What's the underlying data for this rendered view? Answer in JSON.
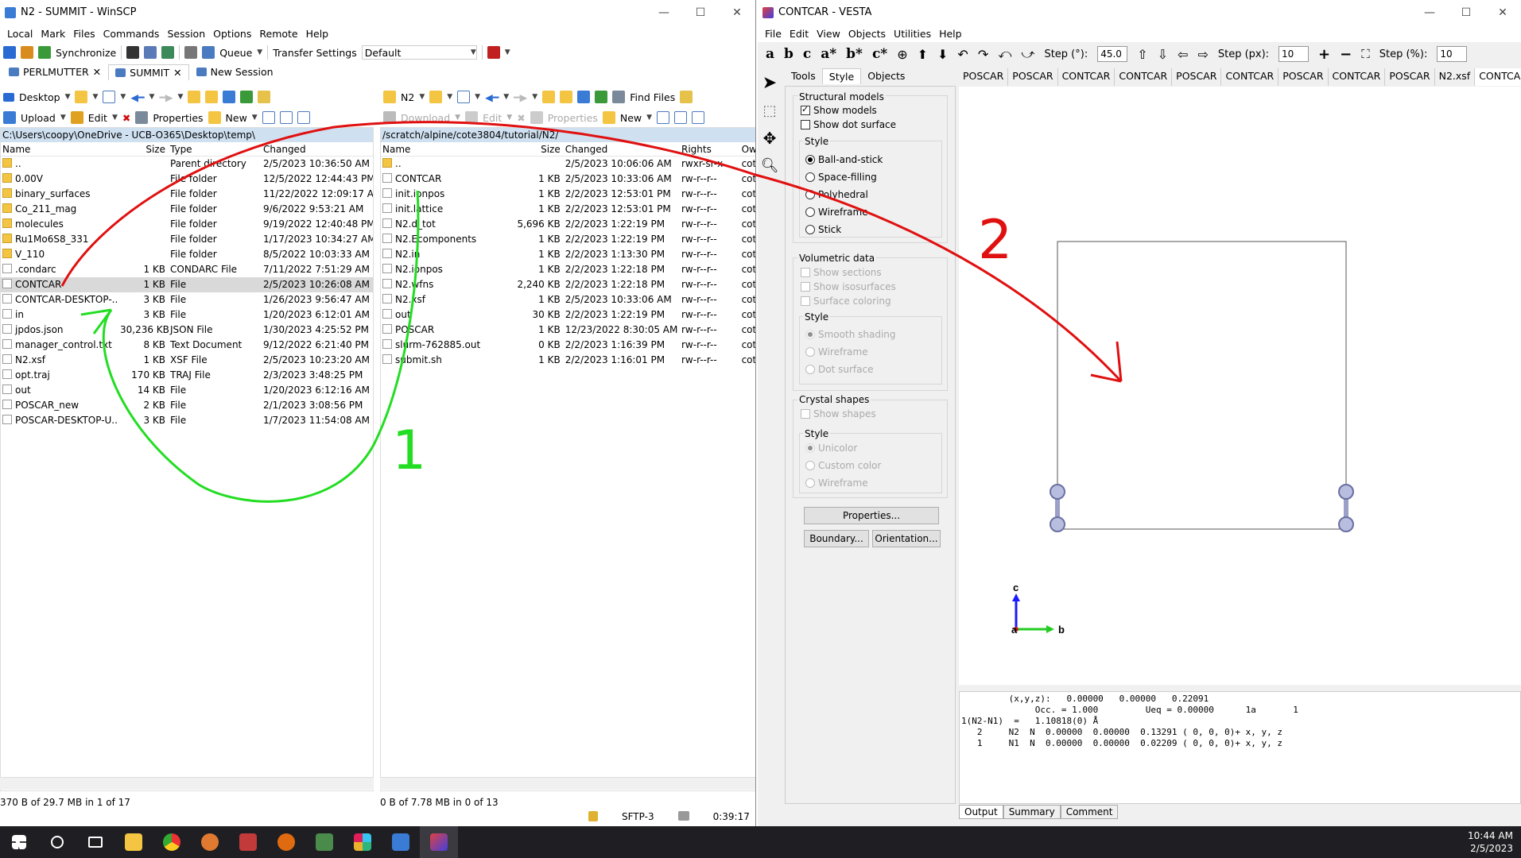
{
  "winscp": {
    "title": "N2 - SUMMIT - WinSCP",
    "menu": [
      "Local",
      "Mark",
      "Files",
      "Commands",
      "Session",
      "Options",
      "Remote",
      "Help"
    ],
    "toolbar": {
      "synchronize": "Synchronize",
      "queue": "Queue",
      "transfer_label": "Transfer Settings",
      "transfer_value": "Default"
    },
    "tabs": [
      {
        "label": "PERLMUTTER"
      },
      {
        "label": "SUMMIT"
      },
      {
        "label": "New Session"
      }
    ],
    "local": {
      "drive": "Desktop",
      "actions": {
        "upload": "Upload",
        "edit": "Edit",
        "properties": "Properties",
        "new": "New"
      },
      "path": "C:\\Users\\coopy\\OneDrive - UCB-O365\\Desktop\\temp\\",
      "columns": [
        "Name",
        "Size",
        "Type",
        "Changed"
      ],
      "rows": [
        {
          "name": "..",
          "size": "",
          "type": "Parent directory",
          "changed": "2/5/2023  10:36:50 AM",
          "icon": "up"
        },
        {
          "name": "0.00V",
          "size": "",
          "type": "File folder",
          "changed": "12/5/2022  12:44:43 PM",
          "icon": "folder"
        },
        {
          "name": "binary_surfaces",
          "size": "",
          "type": "File folder",
          "changed": "11/22/2022  12:09:17 AM",
          "icon": "folder"
        },
        {
          "name": "Co_211_mag",
          "size": "",
          "type": "File folder",
          "changed": "9/6/2022  9:53:21 AM",
          "icon": "folder"
        },
        {
          "name": "molecules",
          "size": "",
          "type": "File folder",
          "changed": "9/19/2022  12:40:48 PM",
          "icon": "folder"
        },
        {
          "name": "Ru1Mo6S8_331",
          "size": "",
          "type": "File folder",
          "changed": "1/17/2023  10:34:27 AM",
          "icon": "folder"
        },
        {
          "name": "V_110",
          "size": "",
          "type": "File folder",
          "changed": "8/5/2022  10:03:33 AM",
          "icon": "folder"
        },
        {
          "name": ".condarc",
          "size": "1 KB",
          "type": "CONDARC File",
          "changed": "7/11/2022  7:51:29 AM",
          "icon": "file"
        },
        {
          "name": "CONTCAR",
          "size": "1 KB",
          "type": "File",
          "changed": "2/5/2023  10:26:08 AM",
          "icon": "file"
        },
        {
          "name": "CONTCAR-DESKTOP-...",
          "size": "3 KB",
          "type": "File",
          "changed": "1/26/2023  9:56:47 AM",
          "icon": "file"
        },
        {
          "name": "in",
          "size": "3 KB",
          "type": "File",
          "changed": "1/20/2023  6:12:01 AM",
          "icon": "file"
        },
        {
          "name": "jpdos.json",
          "size": "30,236 KB",
          "type": "JSON File",
          "changed": "1/30/2023  4:25:52 PM",
          "icon": "file"
        },
        {
          "name": "manager_control.txt",
          "size": "8 KB",
          "type": "Text Document",
          "changed": "9/12/2022  6:21:40 PM",
          "icon": "file"
        },
        {
          "name": "N2.xsf",
          "size": "1 KB",
          "type": "XSF File",
          "changed": "2/5/2023  10:23:20 AM",
          "icon": "file"
        },
        {
          "name": "opt.traj",
          "size": "170 KB",
          "type": "TRAJ File",
          "changed": "2/3/2023  3:48:25 PM",
          "icon": "file"
        },
        {
          "name": "out",
          "size": "14 KB",
          "type": "File",
          "changed": "1/20/2023  6:12:16 AM",
          "icon": "file"
        },
        {
          "name": "POSCAR_new",
          "size": "2 KB",
          "type": "File",
          "changed": "2/1/2023  3:08:56 PM",
          "icon": "file"
        },
        {
          "name": "POSCAR-DESKTOP-U...",
          "size": "3 KB",
          "type": "File",
          "changed": "1/7/2023  11:54:08 AM",
          "icon": "file"
        }
      ],
      "status": "370 B of 29.7 MB in 1 of 17"
    },
    "remote": {
      "drive": "N2",
      "actions": {
        "download": "Download",
        "edit": "Edit",
        "properties": "Properties",
        "new": "New",
        "find": "Find Files"
      },
      "path": "/scratch/alpine/cote3804/tutorial/N2/",
      "columns": [
        "Name",
        "Size",
        "Changed",
        "Rights",
        "Ow"
      ],
      "rows": [
        {
          "name": "..",
          "size": "",
          "changed": "2/5/2023  10:06:06 AM",
          "rights": "rwxr-sr-x",
          "owner": "cot",
          "icon": "up"
        },
        {
          "name": "CONTCAR",
          "size": "1 KB",
          "changed": "2/5/2023  10:33:06 AM",
          "rights": "rw-r--r--",
          "owner": "cot",
          "icon": "file"
        },
        {
          "name": "init.ionpos",
          "size": "1 KB",
          "changed": "2/2/2023  12:53:01 PM",
          "rights": "rw-r--r--",
          "owner": "cot",
          "icon": "file"
        },
        {
          "name": "init.lattice",
          "size": "1 KB",
          "changed": "2/2/2023  12:53:01 PM",
          "rights": "rw-r--r--",
          "owner": "cot",
          "icon": "file"
        },
        {
          "name": "N2.d_tot",
          "size": "5,696 KB",
          "changed": "2/2/2023  1:22:19 PM",
          "rights": "rw-r--r--",
          "owner": "cot",
          "icon": "file"
        },
        {
          "name": "N2.Ecomponents",
          "size": "1 KB",
          "changed": "2/2/2023  1:22:19 PM",
          "rights": "rw-r--r--",
          "owner": "cot",
          "icon": "file"
        },
        {
          "name": "N2.in",
          "size": "1 KB",
          "changed": "2/2/2023  1:13:30 PM",
          "rights": "rw-r--r--",
          "owner": "cot",
          "icon": "file"
        },
        {
          "name": "N2.ionpos",
          "size": "1 KB",
          "changed": "2/2/2023  1:22:18 PM",
          "rights": "rw-r--r--",
          "owner": "cot",
          "icon": "file"
        },
        {
          "name": "N2.wfns",
          "size": "2,240 KB",
          "changed": "2/2/2023  1:22:18 PM",
          "rights": "rw-r--r--",
          "owner": "cot",
          "icon": "file"
        },
        {
          "name": "N2.xsf",
          "size": "1 KB",
          "changed": "2/5/2023  10:33:06 AM",
          "rights": "rw-r--r--",
          "owner": "cot",
          "icon": "file"
        },
        {
          "name": "out",
          "size": "30 KB",
          "changed": "2/2/2023  1:22:19 PM",
          "rights": "rw-r--r--",
          "owner": "cot",
          "icon": "file"
        },
        {
          "name": "POSCAR",
          "size": "1 KB",
          "changed": "12/23/2022  8:30:05 AM",
          "rights": "rw-r--r--",
          "owner": "cot",
          "icon": "file"
        },
        {
          "name": "slurm-762885.out",
          "size": "0 KB",
          "changed": "2/2/2023  1:16:39 PM",
          "rights": "rw-r--r--",
          "owner": "cot",
          "icon": "file"
        },
        {
          "name": "submit.sh",
          "size": "1 KB",
          "changed": "2/2/2023  1:16:01 PM",
          "rights": "rw-r--r--",
          "owner": "cot",
          "icon": "file"
        }
      ],
      "status": "0 B of 7.78 MB in 0 of 13"
    },
    "status_right": {
      "protocol": "SFTP-3",
      "time": "0:39:17"
    }
  },
  "vesta": {
    "title": "CONTCAR - VESTA",
    "menu": [
      "File",
      "Edit",
      "View",
      "Objects",
      "Utilities",
      "Help"
    ],
    "axes_buttons": [
      "a",
      "b",
      "c",
      "a*",
      "b*",
      "c*"
    ],
    "step_deg_label": "Step (°):",
    "step_deg": "45.0",
    "step_px_label": "Step (px):",
    "step_px": "10",
    "step_pct_label": "Step (%):",
    "step_pct": "10",
    "side_tabs": [
      "Tools",
      "Style",
      "Objects"
    ],
    "file_tabs": [
      "POSCAR",
      "POSCAR",
      "CONTCAR",
      "CONTCAR",
      "POSCAR",
      "CONTCAR",
      "POSCAR",
      "CONTCAR",
      "POSCAR",
      "N2.xsf",
      "CONTCAR"
    ],
    "structural": {
      "title": "Structural models",
      "show_models": "Show models",
      "show_dots": "Show dot surface",
      "style_title": "Style",
      "styles": [
        "Ball-and-stick",
        "Space-filling",
        "Polyhedral",
        "Wireframe",
        "Stick"
      ]
    },
    "volumetric": {
      "title": "Volumetric data",
      "options": [
        "Show sections",
        "Show isosurfaces",
        "Surface coloring"
      ],
      "style_title": "Style",
      "styles": [
        "Smooth shading",
        "Wireframe",
        "Dot surface"
      ]
    },
    "crystal": {
      "title": "Crystal shapes",
      "show": "Show shapes",
      "style_title": "Style",
      "styles": [
        "Unicolor",
        "Custom color",
        "Wireframe"
      ]
    },
    "buttons": {
      "properties": "Properties...",
      "boundary": "Boundary...",
      "orientation": "Orientation..."
    },
    "axis_labels": {
      "c": "c",
      "a": "a",
      "b": "b"
    },
    "output_lines": [
      "         (x,y,z):   0.00000   0.00000   0.22091",
      "              Occ. = 1.000         Ueq = 0.00000      1a       1",
      "",
      "1(N2-N1)  =   1.10818(0) Å",
      "   2     N2  N  0.00000  0.00000  0.13291 ( 0, 0, 0)+ x, y, z",
      "   1     N1  N  0.00000  0.00000  0.02209 ( 0, 0, 0)+ x, y, z"
    ],
    "output_tabs": [
      "Output",
      "Summary",
      "Comment"
    ]
  },
  "annotations": {
    "label1": "1",
    "label2": "2",
    "green": "#22dd22",
    "red": "#e01010"
  },
  "taskbar": {
    "time": "10:44 AM",
    "date": "2/5/2023"
  }
}
